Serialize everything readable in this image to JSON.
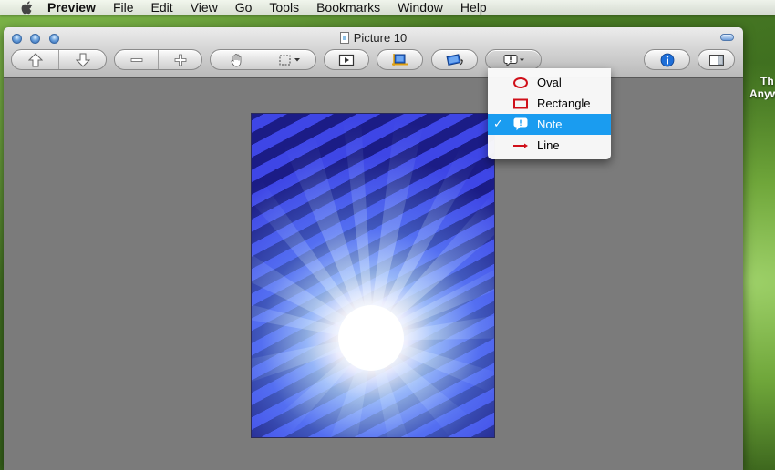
{
  "menubar": {
    "apple_icon": "apple-icon",
    "app_name": "Preview",
    "items": [
      "File",
      "Edit",
      "View",
      "Go",
      "Tools",
      "Bookmarks",
      "Window",
      "Help"
    ]
  },
  "window": {
    "title": "Picture 10"
  },
  "toolbar": {
    "previous_icon": "arrow-up-icon",
    "next_icon": "arrow-down-icon",
    "zoom_out_icon": "minus-icon",
    "zoom_in_icon": "plus-icon",
    "move_icon": "hand-icon",
    "select_icon": "marquee-select-icon",
    "slideshow_icon": "slideshow-icon",
    "crop_icon": "crop-icon",
    "rotate_icon": "rotate-icon",
    "annotate_icon": "note-icon",
    "inspector_icon": "info-icon",
    "sidebar_icon": "sidebar-icon"
  },
  "annotate_menu": {
    "items": [
      {
        "label": "Oval",
        "icon": "oval-icon",
        "checked": false
      },
      {
        "label": "Rectangle",
        "icon": "rectangle-icon",
        "checked": false
      },
      {
        "label": "Note",
        "icon": "note-icon",
        "checked": true
      },
      {
        "label": "Line",
        "icon": "line-icon",
        "checked": false
      }
    ],
    "check_mark": "✓",
    "accent_color": "#1a9cf0",
    "icon_color": "#d0101a"
  },
  "desktop": {
    "text_lines": [
      "Th",
      "Anyw"
    ]
  }
}
